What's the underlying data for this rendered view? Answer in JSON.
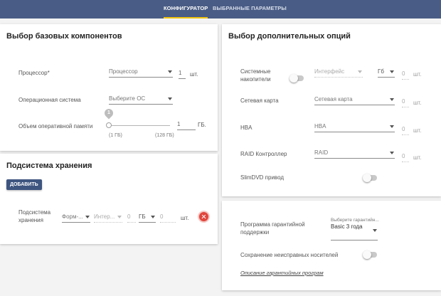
{
  "tabs": [
    {
      "label": "Конфигуратор",
      "active": true
    },
    {
      "label": "Выбранные параметры",
      "active": false
    }
  ],
  "base": {
    "title": "Выбор базовых компонентов",
    "cpu": {
      "label": "Процессор*",
      "value": "Процессор",
      "qty": "1",
      "unit": "шт."
    },
    "os": {
      "label": "Операционная система",
      "value": "Выберите ОС"
    },
    "ram": {
      "label": "Объем оперативной памяти",
      "bubble": "1",
      "min": "(1 ГБ)",
      "max": "(128 ГБ)",
      "value": "1",
      "unit": "ГБ."
    }
  },
  "storage": {
    "title": "Подсистема хранения",
    "add_button": "Добавить",
    "row": {
      "label": "Подсистема хранения",
      "form": "Форм-...",
      "interface": "Интер...",
      "size": "0",
      "size_unit": "ГБ",
      "qty": "0",
      "qty_unit": "шт."
    }
  },
  "options": {
    "title": "Выбор дополнительных опций",
    "drives": {
      "label": "Системные накопители",
      "interface": "Интерфейс",
      "unit_select": "Гб",
      "qty": "0",
      "unit": "шт."
    },
    "nic": {
      "label": "Сетевая карта",
      "value": "Сетевая карта",
      "qty": "0",
      "unit": "шт."
    },
    "hba": {
      "label": "HBA",
      "value": "HBA",
      "qty": "0",
      "unit": "шт."
    },
    "raid": {
      "label": "RAID Контроллер",
      "value": "RAID",
      "qty": "0",
      "unit": "шт."
    },
    "dvd": {
      "label": "SlimDVD привод"
    }
  },
  "warranty": {
    "program_label": "Программа гарантийной поддержки",
    "select_label": "Выберите гарантийн...",
    "value": "Basic 3 года",
    "keep_label": "Сохранение неисправных носителей",
    "link": "Описание гарантийных програм"
  },
  "colors": {
    "header": "#495c85",
    "accent": "#f1c40f",
    "button": "#3e5580",
    "danger": "#e0453c"
  }
}
